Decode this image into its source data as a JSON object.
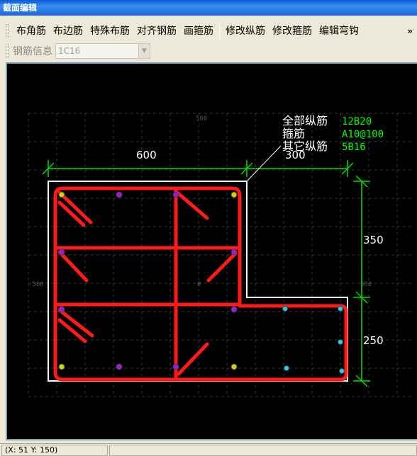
{
  "window": {
    "title": "截面编辑"
  },
  "menu": {
    "items": [
      "布角筋",
      "布边筋",
      "特殊布筋",
      "对齐钢筋",
      "画箍筋"
    ],
    "items2": [
      "修改纵筋",
      "修改箍筋",
      "编辑弯钩"
    ],
    "overflow": "»"
  },
  "rebar_info": {
    "label": "钢筋信息",
    "value": "1C16"
  },
  "drawing": {
    "grid_labels": {
      "top": "500",
      "left": "-500",
      "center": "0",
      "right": "500"
    },
    "dimensions": {
      "top_left": "600",
      "top_right": "300",
      "right_upper": "350",
      "right_lower": "250"
    },
    "legend": {
      "rows": [
        {
          "label": "全部纵筋",
          "value": "12B20"
        },
        {
          "label": "箍筋",
          "value": "A10@100"
        },
        {
          "label": "其它纵筋",
          "value": "5B16"
        }
      ]
    },
    "colors": {
      "stirrup": "#ff1a1a",
      "dim": "#00e000",
      "outline": "#ffffff",
      "value": "#00ff00"
    }
  },
  "status": {
    "coords": "(X: 51 Y: 150)"
  }
}
